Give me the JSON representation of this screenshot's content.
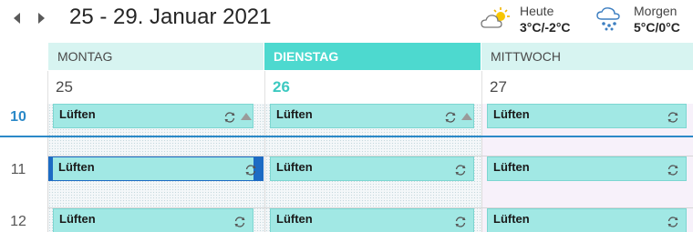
{
  "header": {
    "prev_icon": "chevron-left-icon",
    "next_icon": "chevron-right-icon",
    "title": "25 - 29. Januar 2021"
  },
  "weather": {
    "today": {
      "label": "Heute",
      "temp": "3°C/-2°C",
      "icon": "partly-sunny-icon"
    },
    "tomorrow": {
      "label": "Morgen",
      "temp": "5°C/0°C",
      "icon": "snow-icon"
    }
  },
  "days": [
    {
      "name": "MONTAG",
      "date": "25",
      "today": false
    },
    {
      "name": "DIENSTAG",
      "date": "26",
      "today": true
    },
    {
      "name": "MITTWOCH",
      "date": "27",
      "today": false
    }
  ],
  "hours": [
    "10",
    "11",
    "12"
  ],
  "current_hour": "10",
  "event_title": "Lüften",
  "events": [
    {
      "day": 0,
      "hour": "10",
      "title": "Lüften",
      "recurring": true,
      "warning": true,
      "selected": false
    },
    {
      "day": 1,
      "hour": "10",
      "title": "Lüften",
      "recurring": true,
      "warning": true,
      "selected": false
    },
    {
      "day": 2,
      "hour": "10",
      "title": "Lüften",
      "recurring": true,
      "warning": false,
      "selected": false
    },
    {
      "day": 0,
      "hour": "11",
      "title": "Lüften",
      "recurring": true,
      "warning": false,
      "selected": true
    },
    {
      "day": 1,
      "hour": "11",
      "title": "Lüften",
      "recurring": true,
      "warning": false,
      "selected": false
    },
    {
      "day": 2,
      "hour": "11",
      "title": "Lüften",
      "recurring": true,
      "warning": false,
      "selected": false
    },
    {
      "day": 0,
      "hour": "12",
      "title": "Lüften",
      "recurring": true,
      "warning": false,
      "selected": false
    },
    {
      "day": 1,
      "hour": "12",
      "title": "Lüften",
      "recurring": true,
      "warning": false,
      "selected": false
    },
    {
      "day": 2,
      "hour": "12",
      "title": "Lüften",
      "recurring": true,
      "warning": false,
      "selected": false
    }
  ],
  "colors": {
    "accent": "#4dd9cf",
    "event": "#a1e8e4",
    "selected": "#1d6bc4",
    "now_line": "#2b89c8"
  }
}
